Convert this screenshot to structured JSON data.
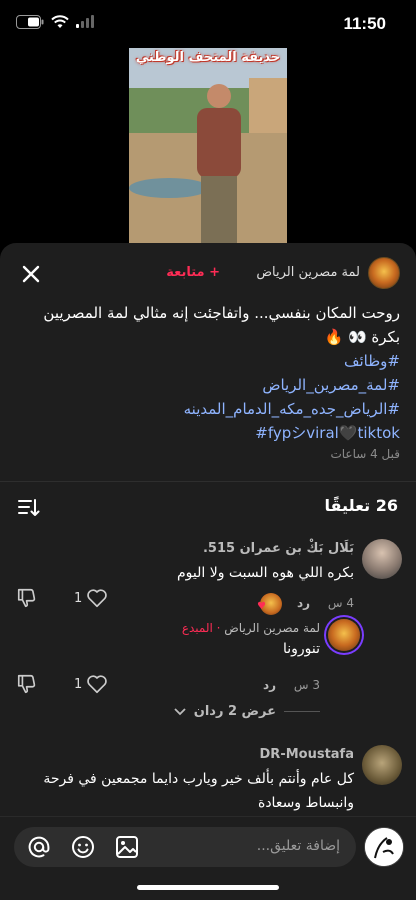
{
  "status_bar": {
    "time": "11:50"
  },
  "video": {
    "caption": "حديقة المتحف الوطني"
  },
  "post": {
    "author_name": "لمة مصرين الرياض",
    "follow_label": "+ متابعة",
    "description": "روحت المكان بنفسي... واتفاجئت إنه مثالي لمة المصريين بكرة 👀 🔥",
    "hashtags": [
      "#وظائف",
      "#لمة_مصرين_الرياض",
      "#الرياض_جده_مكه_الدمام_المدينه",
      "#fypシviral🖤tiktok"
    ],
    "time_ago": "قبل 4 ساعات"
  },
  "comments_header": {
    "count_label": "26 تعليقًا"
  },
  "comments": [
    {
      "name": "بَلَال بَكْ بن عمران 515.",
      "text": "بكره اللي هوه السبت ولا اليوم",
      "time": "4 س",
      "reply_label": "رد",
      "likes": "1",
      "reply": {
        "name": "لمة مصرين الرياض",
        "tag": "· المبدع",
        "text": "تنورونا",
        "time": "3 س",
        "reply_label": "رد",
        "likes": "1"
      },
      "view_replies": "عرض 2 ردان"
    },
    {
      "name": "DR-Moustafa",
      "text": "كل عام وأنتم بألف خير ويارب دايما مجمعين في فرحة وانبساط وسعادة"
    }
  ],
  "input": {
    "placeholder": "إضافة تعليق..."
  },
  "colors": {
    "accent": "#fe2c55",
    "hashtag": "#8fb4ff",
    "sheet_bg": "#1e1e1e"
  }
}
